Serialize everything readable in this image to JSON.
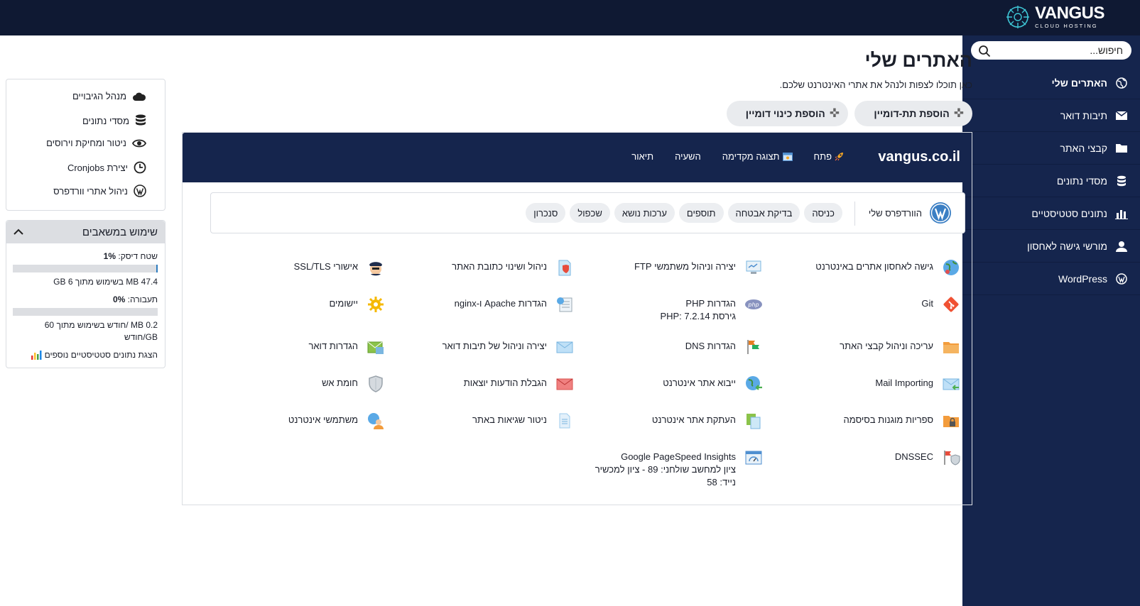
{
  "logo": {
    "main": "VANGUS",
    "sub": "CLOUD HOSTING"
  },
  "search": {
    "placeholder": "חיפוש..."
  },
  "sidebar": {
    "items": [
      {
        "label": "האתרים שלי",
        "icon": "globe-icon"
      },
      {
        "label": "תיבות דואר",
        "icon": "envelope-icon"
      },
      {
        "label": "קבצי האתר",
        "icon": "folder-icon"
      },
      {
        "label": "מסדי נתונים",
        "icon": "database-icon"
      },
      {
        "label": "נתונים סטטיסטיים",
        "icon": "chart-icon"
      },
      {
        "label": "מורשי גישה לאחסון",
        "icon": "user-icon"
      },
      {
        "label": "WordPress",
        "icon": "wordpress-icon"
      }
    ]
  },
  "main": {
    "title": "האתרים שלי",
    "subtitle": "כאן תוכלו לצפות ולנהל את אתרי האינטרנט שלכם.",
    "add_subdomain": "הוספת תת-דומיין",
    "add_alias": "הוספת כינוי דומיין"
  },
  "domain": {
    "name": "vangus.co.il",
    "links": {
      "open": "פתח",
      "preview": "תצוגה מקדימה",
      "suspend": "השעיה",
      "description": "תיאור"
    }
  },
  "wordpress": {
    "title": "הוורדפרס שלי",
    "chips": [
      "כניסה",
      "בדיקת אבטחה",
      "תוספים",
      "ערכות נושא",
      "שכפול",
      "סנכרון"
    ]
  },
  "tools": {
    "web_access": "גישה לאחסון אתרים באינטרנט",
    "ftp": "יצירה וניהול משתמשי FTP",
    "address": "ניהול ושינוי כתובת האתר",
    "ssl": "אישורי SSL/TLS",
    "git": "Git",
    "php": "הגדרות PHP",
    "php_version": "גירסת PHP: 7.2.14",
    "apache": "הגדרות Apache ו-nginx",
    "apps": "יישומים",
    "file_manager": "עריכה וניהול קבצי האתר",
    "dns": "הגדרות DNS",
    "mailboxes": "יצירה וניהול של תיבות דואר",
    "mail_settings": "הגדרות דואר",
    "mail_importing": "Mail Importing",
    "site_import": "ייבוא אתר אינטרנט",
    "outgoing": "הגבלת הודעות יוצאות",
    "firewall": "חומת אש",
    "protected_dirs": "ספריות מוגנות בסיסמה",
    "site_copy": "העתקת אתר אינטרנט",
    "error_logs": "ניטור שגיאות באתר",
    "web_users": "משתמשי אינטרנט",
    "dnssec": "DNSSEC",
    "pagespeed": "Google PageSpeed Insights",
    "pagespeed_sub": "ציון למחשב שולחני: 89 - ציון למכשיר נייד: 58"
  },
  "side_links": [
    {
      "label": "מנהל הגיבויים",
      "icon": "cloud-icon"
    },
    {
      "label": "מסדי נתונים",
      "icon": "database-icon"
    },
    {
      "label": "ניטור ומחיקת וירוסים",
      "icon": "eye-icon"
    },
    {
      "label": "יצירת Cronjobs",
      "icon": "clock-icon"
    },
    {
      "label": "ניהול אתרי וורדפרס",
      "icon": "wordpress-icon"
    }
  ],
  "usage": {
    "title": "שימוש במשאבים",
    "disk_label": "שטח דיסק:",
    "disk_pct": "1%",
    "disk_detail": "47.4 MB בשימוש מתוך 6 GB",
    "disk_fraction": 0.01,
    "traffic_label": "תעבורה:",
    "traffic_pct": "0%",
    "traffic_detail": "0.2 MB /חודש בשימוש מתוך 60 GB/חודש",
    "traffic_fraction": 0.0,
    "more_stats": "הצגת נתונים סטטיסטיים נוספים"
  }
}
